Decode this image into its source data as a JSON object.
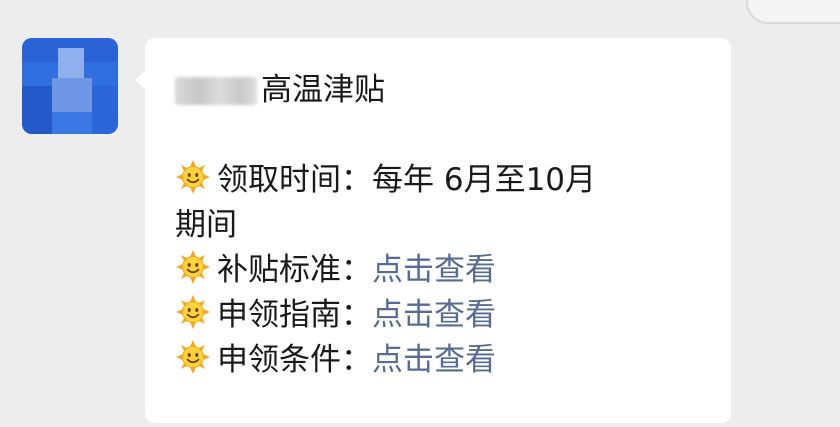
{
  "message": {
    "title": "高温津贴",
    "lines": [
      {
        "label": "领取时间",
        "sep": "：",
        "value": "每年 6月至10月"
      },
      {
        "continuation": "期间"
      },
      {
        "label": "补贴标准",
        "sep": "：",
        "link": "点击查看"
      },
      {
        "label": "申领指南",
        "sep": "：",
        "link": "点击查看"
      },
      {
        "label": "申领条件",
        "sep": "：",
        "link": "点击查看"
      }
    ]
  },
  "icons": {
    "line_icon": "sun-emoji-icon",
    "avatar": "pixelated-avatar"
  },
  "colors": {
    "background": "#ededed",
    "bubble": "#ffffff",
    "text": "#1a1a1a",
    "link": "#576b95",
    "avatar": "#2f6fe2"
  }
}
